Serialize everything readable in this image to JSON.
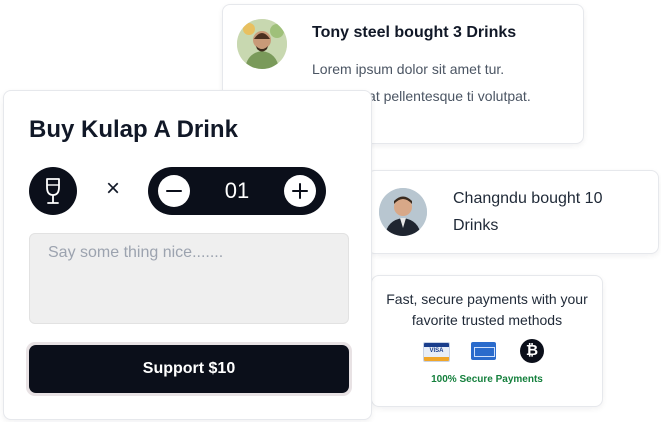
{
  "feed": [
    {
      "title": "Tony steel bought 3 Drinks",
      "body": "Lorem ipsum dolor sit amet tur. Consequat pellentesque ti volutpat."
    },
    {
      "title": "Changndu bought 10 Drinks"
    }
  ],
  "payments": {
    "text": "Fast, secure payments with your favorite trusted methods",
    "visa_label": "VISA",
    "btc_symbol": "₿",
    "secure_label": "100% Secure Payments",
    "icons": [
      "visa-card-icon",
      "amex-card-icon",
      "bitcoin-icon"
    ]
  },
  "donation": {
    "heading": "Buy Kulap A Drink",
    "times": "×",
    "quantity": "01",
    "message_placeholder": "Say some thing nice.......",
    "support_label": "Support $10",
    "icons": [
      "wine-glass-icon",
      "minus-icon",
      "plus-icon"
    ]
  },
  "colors": {
    "primary_dark": "#0b0f1a",
    "secure_green": "#15803d",
    "input_bg": "#efefef"
  }
}
